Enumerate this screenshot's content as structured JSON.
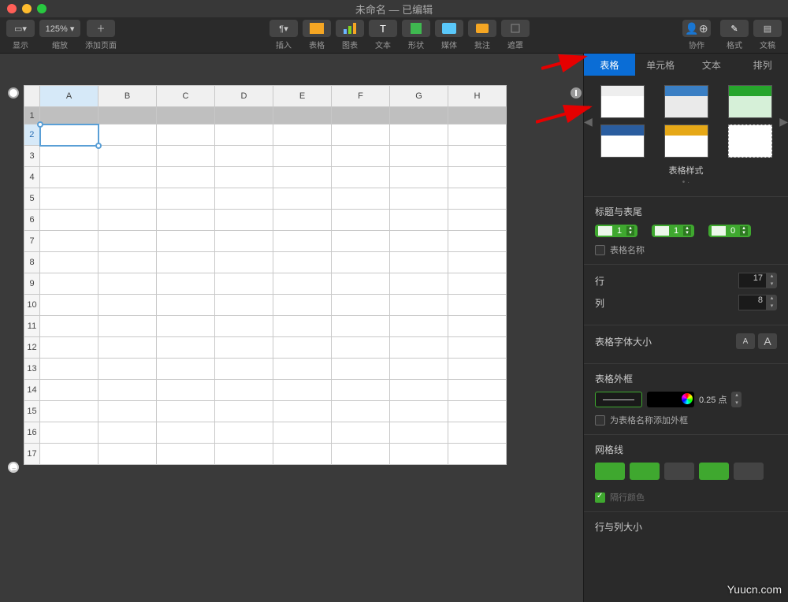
{
  "title": "未命名 — 已编辑",
  "toolbar": {
    "left": [
      {
        "label": "显示",
        "btn": "▭▾"
      },
      {
        "label": "缩放",
        "btn": "125% ▾"
      },
      {
        "label": "添加页面",
        "btn": "＋"
      }
    ],
    "center": [
      {
        "label": "插入",
        "btn": "¶▾"
      },
      {
        "label": "表格"
      },
      {
        "label": "图表"
      },
      {
        "label": "文本",
        "btn": "T"
      },
      {
        "label": "形状"
      },
      {
        "label": "媒体"
      },
      {
        "label": "批注"
      },
      {
        "label": "遮罩"
      }
    ],
    "right": [
      {
        "label": "协作"
      },
      {
        "label": "格式"
      },
      {
        "label": "文稿"
      }
    ]
  },
  "table": {
    "columns": [
      "A",
      "B",
      "C",
      "D",
      "E",
      "F",
      "G",
      "H"
    ],
    "rows": 17,
    "selected_row": 2,
    "selected_col": "A"
  },
  "inspector": {
    "tabs": [
      "表格",
      "单元格",
      "文本",
      "排列"
    ],
    "active_tab": 0,
    "styles_title": "表格样式",
    "header_footer": {
      "title": "标题与表尾",
      "header_rows": 1,
      "header_cols": 1,
      "footer_rows": 0,
      "table_name": "表格名称"
    },
    "rows_label": "行",
    "rows_value": 17,
    "cols_label": "列",
    "cols_value": 8,
    "font_size_label": "表格字体大小",
    "outline": {
      "title": "表格外框",
      "width": "0.25 点",
      "add_name_outline": "为表格名称添加外框"
    },
    "gridlines_title": "网格线",
    "row_col_size_title": "行与列大小"
  },
  "watermark": "Yuucn.com"
}
